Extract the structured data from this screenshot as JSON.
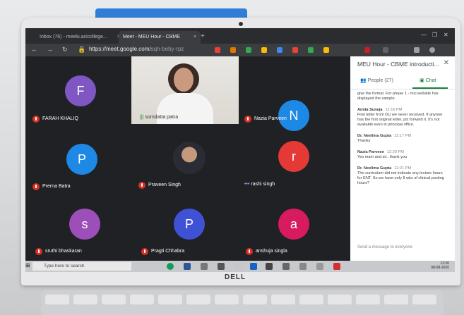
{
  "browser": {
    "tabs": [
      {
        "label": "Inbox (76) - meelu.acicollege..."
      },
      {
        "label": "Meet - MEU Hour - CBME"
      }
    ],
    "url": "https://meet.google.com/",
    "url_dim": "sqh-beby-rpz"
  },
  "meet": {
    "participants": [
      {
        "initial": "F",
        "name": "FARAH KHALIQ",
        "color": "#7e57c2"
      },
      {
        "initial": "",
        "name": "somdatta patra",
        "color": ""
      },
      {
        "initial": "N",
        "name": "Nazia Parveen",
        "color": "#1e88e5"
      },
      {
        "initial": "P",
        "name": "Prerna Batra",
        "color": "#1e88e5"
      },
      {
        "initial": "",
        "name": "Praveen Singh",
        "color": ""
      },
      {
        "initial": "r",
        "name": "rashi singh",
        "color": "#e53935"
      },
      {
        "initial": "s",
        "name": "sruthi bhaskaran",
        "color": "#9c4fb8"
      },
      {
        "initial": "P",
        "name": "Pragti Chhabra",
        "color": "#3f51d5"
      },
      {
        "initial": "a",
        "name": "anshuja singla",
        "color": "#d81b60"
      }
    ]
  },
  "panel": {
    "title": "MEU Hour - CBME introducti...",
    "tab_people": "People (27)",
    "tab_chat": "Chat",
    "messages": [
      {
        "who": "",
        "time": "",
        "text": "give the format. For phase 1 - mci website has displayed the sample."
      },
      {
        "who": "Amita Suneja",
        "time": "12:16 PM",
        "text": "First letter from DU we never received. If anyone has the first original letter, plz forward it. It's not available even in principal office."
      },
      {
        "who": "Dr. Neelima Gupta",
        "time": "12:17 PM",
        "text": "Thanks"
      },
      {
        "who": "Nazia Parveen",
        "time": "12:20 PM",
        "text": "Yes mam and sir.. thank you"
      },
      {
        "who": "Dr. Neelima Gupta",
        "time": "12:21 PM",
        "text": "The curriculum did not indicate any lecture hours for ENT. So we have only 8 wks of clinical posting hours?"
      }
    ],
    "compose_placeholder": "Send a message to everyone"
  },
  "taskbar": {
    "search": "Type here to search",
    "time": "12:26",
    "date": "08-08-2020"
  },
  "laptop_brand": "DELL",
  "colors": {
    "chat_green": "#188038",
    "meet_bg": "#202124",
    "mute_red": "#d93025"
  }
}
